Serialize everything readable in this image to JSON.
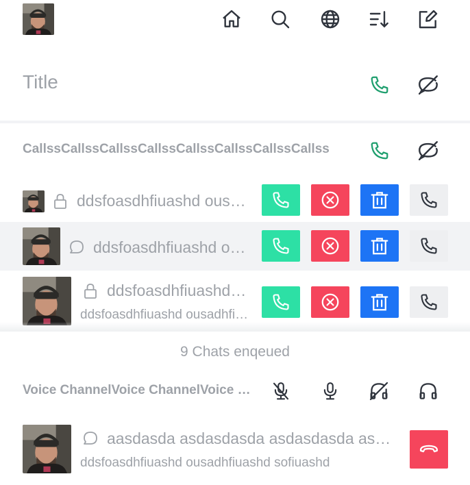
{
  "header": {
    "icons": [
      "home-icon",
      "search-icon",
      "globe-icon",
      "sort-icon",
      "edit-icon"
    ]
  },
  "title_row": {
    "title": "Title"
  },
  "calls_section": {
    "title": "CallssCallssCallssCallssCallssCallssCallssCallss"
  },
  "rows": [
    {
      "name": "ddsfoasdhfiuashd ousadhfiuashd",
      "status_icon": "lock-icon"
    },
    {
      "name": "ddsfoasdhfiuashd ousadhfiuashd",
      "status_icon": "chat-bubble-icon"
    },
    {
      "name": "ddsfoasdhfiuashd ousadhfiuashd",
      "subtitle": "ddsfoasdhfiuashd ousadhfiuashd",
      "status_icon": "lock-icon"
    }
  ],
  "queue": {
    "enqueued_text": "9 Chats enqeued"
  },
  "voice_section": {
    "title": "Voice ChannelVoice ChannelVoice Channel"
  },
  "voice_row": {
    "name": "aasdasda asdasdasda asdasdasda asdasdasda",
    "subtitle": "ddsfoasdhfiuashd ousadhfiuashd sofiuashd",
    "status_icon": "chat-bubble-icon"
  },
  "colors": {
    "accept": "#2de0a5",
    "decline": "#f5455c",
    "delete": "#1d74f5",
    "call_icon_green": "#1f9f6e",
    "neutral_bg": "#eeeff1",
    "muted_text": "#9ea2a8"
  }
}
